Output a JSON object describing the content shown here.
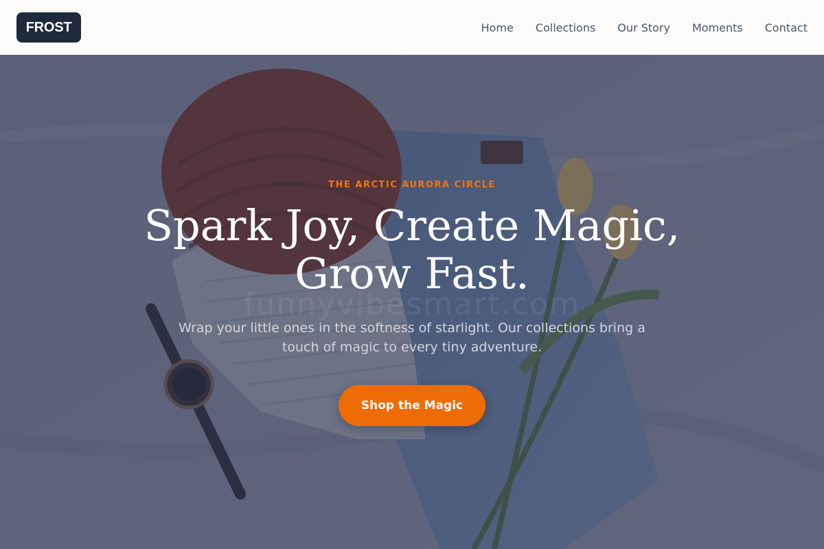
{
  "header": {
    "logo_text": "FROST",
    "nav": [
      {
        "label": "Home"
      },
      {
        "label": "Collections"
      },
      {
        "label": "Our Story"
      },
      {
        "label": "Moments"
      },
      {
        "label": "Contact"
      }
    ]
  },
  "hero": {
    "eyebrow": "THE ARCTIC AURORA CIRCLE",
    "title": "Spark Joy, Create Magic, Grow Fast.",
    "subtitle": "Wrap your little ones in the softness of starlight. Our collections bring a touch of magic to every tiny adventure.",
    "cta_label": "Shop the Magic",
    "watermark": "funnyvibesmart.com",
    "background_image": "flat-lay-knit-beanie-sweater-jeans-watch-tulips"
  },
  "colors": {
    "logo_bg": "#1e293b",
    "accent": "#ee6c06",
    "eyebrow": "#f2750b",
    "nav_text": "#475569",
    "overlay": "#2c324e"
  }
}
